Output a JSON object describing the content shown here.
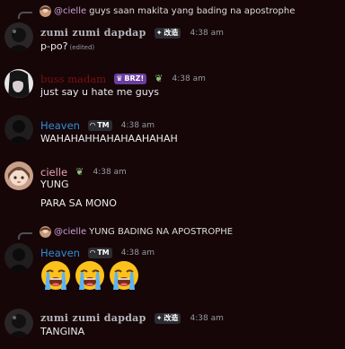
{
  "messages": [
    {
      "reply": {
        "mention": "@cielle",
        "text": "guys saan makita yang bading na apostrophe"
      },
      "author": "zumi zumi dapdap",
      "tag_text": "改造",
      "time": "4:38 am",
      "lines": [
        "p-po?"
      ],
      "edited": "(edited)"
    },
    {
      "author": "buss madam",
      "tag_text": "BRZ!",
      "role_icon": "leaf-icon",
      "time": "4:38 am",
      "lines": [
        "just say u hate me guys"
      ]
    },
    {
      "author": "Heaven",
      "tag_text": "TM",
      "time": "4:38 am",
      "lines": [
        "WAHAHAHHAHAHAAHAHAH"
      ]
    },
    {
      "author": "cielle",
      "role_icon": "leaf-icon",
      "time": "4:38 am",
      "lines": [
        "YUNG",
        "PARA SA MONO"
      ]
    },
    {
      "reply": {
        "mention": "@cielle",
        "text": "YUNG BADING NA APOSTROPHE"
      },
      "author": "Heaven",
      "tag_text": "TM",
      "time": "4:38 am",
      "emoji": [
        "loudly-crying-face-icon",
        "loudly-crying-face-icon",
        "loudly-crying-face-icon"
      ]
    },
    {
      "author": "zumi zumi dapdap",
      "tag_text": "改造",
      "time": "4:38 am",
      "lines": [
        "TANGINA"
      ]
    }
  ],
  "colors": {
    "background": "#160608",
    "heaven": "#2e8fd8",
    "cielle": "#e8a4b8",
    "buss": "#7a1010"
  }
}
